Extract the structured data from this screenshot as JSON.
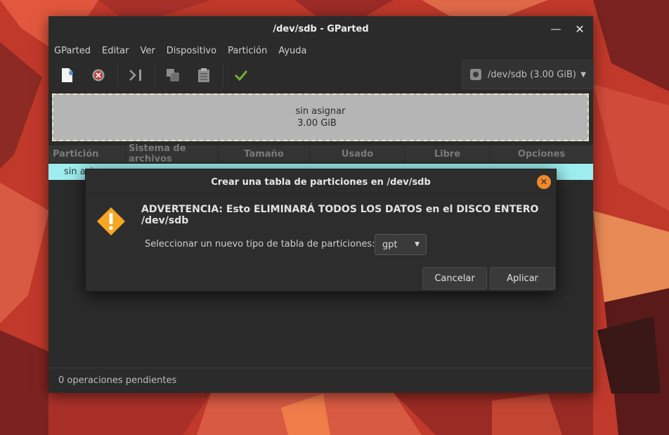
{
  "window": {
    "title": "/dev/sdb - GParted"
  },
  "menu": [
    "GParted",
    "Editar",
    "Ver",
    "Dispositivo",
    "Partición",
    "Ayuda"
  ],
  "toolbar": {
    "icons": [
      "new-icon",
      "delete-icon",
      "resize-move-icon",
      "copy-icon",
      "paste-icon",
      "apply-icon"
    ],
    "device_label": "/dev/sdb (3.00 GiB)"
  },
  "partition_graphic": {
    "name": "sin asignar",
    "size": "3.00 GiB"
  },
  "table": {
    "columns": [
      "Partición",
      "Sistema de archivos",
      "Tamaño",
      "Usado",
      "Libre",
      "Opciones"
    ],
    "rows": [
      {
        "partition": "sin asignar"
      }
    ]
  },
  "status": "0 operaciones pendientes",
  "dialog": {
    "title": "Crear una tabla de particiones en /dev/sdb",
    "heading": "ADVERTENCIA: Esto ELIMINARÁ TODOS LOS DATOS en el DISCO ENTERO /dev/sdb",
    "label": "Seleccionar un nuevo tipo de tabla de particiones:",
    "selected_type": "gpt",
    "cancel": "Cancelar",
    "apply": "Aplicar"
  },
  "colors": {
    "accent_close": "#f0892a",
    "unallocated_row": "#9eeef0",
    "warning": "#f5a623"
  }
}
